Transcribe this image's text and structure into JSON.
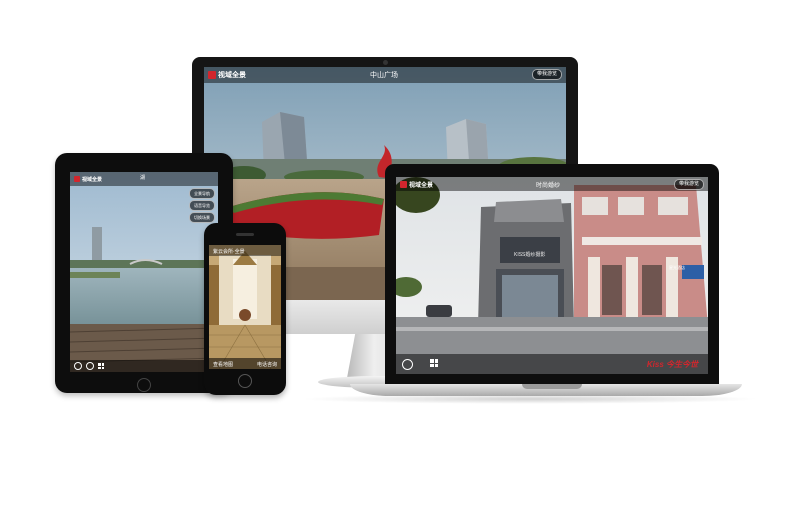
{
  "brand": {
    "logo_text": "视域全景",
    "accent": "#d2262d"
  },
  "monitor": {
    "scene_title": "中山广场",
    "tour_button": "带我游览"
  },
  "tablet": {
    "scene_title": "湖",
    "side_buttons": [
      "全景导航",
      "语音导览",
      "切换场景"
    ]
  },
  "phone": {
    "header_text": "紫云会所·全景",
    "bottom_left": "查看地图",
    "bottom_right": "电话咨询"
  },
  "laptop": {
    "scene_title": "时尚婚纱",
    "tour_button": "带我游览",
    "shop_sign": "KISS婚纱摄影",
    "right_sign": "星光酒店",
    "watermark": "Kiss 今生今世"
  },
  "icons": [
    "logo-mark-icon",
    "play-icon",
    "thumbnails-icon",
    "camera-icon",
    "home-button-icon"
  ]
}
